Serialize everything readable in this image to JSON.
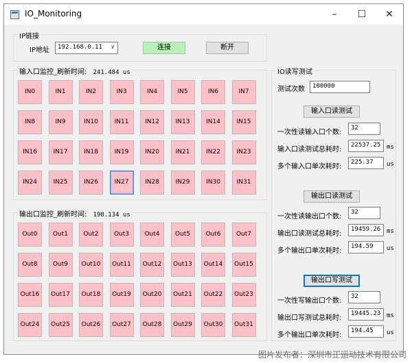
{
  "window": {
    "title": "IO_Monitoring",
    "minimize_label": "–",
    "maximize_label": "☐",
    "close_label": "✕"
  },
  "ip_group": {
    "title": "IP链接",
    "ip_label": "IP地址",
    "ip_value": "192.168.0.11",
    "connect_label": "连接",
    "disconnect_label": "断开"
  },
  "input_group": {
    "title": "输入口监控_刷新时间:",
    "refresh_time": "241.484 us",
    "cells": [
      "IN0",
      "IN1",
      "IN2",
      "IN3",
      "IN4",
      "IN5",
      "IN6",
      "IN7",
      "IN8",
      "IN9",
      "IN10",
      "IN11",
      "IN12",
      "IN13",
      "IN14",
      "IN15",
      "IN16",
      "IN17",
      "IN18",
      "IN19",
      "IN20",
      "IN21",
      "IN22",
      "IN23",
      "IN24",
      "IN25",
      "IN26",
      "IN27",
      "IN28",
      "IN29",
      "IN30",
      "IN31"
    ]
  },
  "output_group": {
    "title": "输出口监控_刷新时间:",
    "refresh_time": "198.134 us",
    "cells": [
      "Out0",
      "Out1",
      "Out2",
      "Out3",
      "Out4",
      "Out5",
      "Out6",
      "Out7",
      "Out8",
      "Out9",
      "Out10",
      "Out11",
      "Out12",
      "Out13",
      "Out14",
      "Out15",
      "Out16",
      "Out17",
      "Out18",
      "Out19",
      "Out20",
      "Out21",
      "Out22",
      "Out23",
      "Out24",
      "Out25",
      "Out26",
      "Out27",
      "Out28",
      "Out29",
      "Out30",
      "Out31"
    ]
  },
  "io_test": {
    "title": "IO读写测试",
    "count_label": "测试次数",
    "count_value": "100000",
    "input_read": {
      "button": "输入口读测试",
      "count_label": "一次性读输入口个数:",
      "count_value": "32",
      "total_label": "输入口读测试总耗时:",
      "total_value": "22537.25",
      "total_unit": "ms",
      "single_label": "多个输入口单次耗时:",
      "single_value": "225.37",
      "single_unit": "us"
    },
    "output_read": {
      "button": "输出口读测试",
      "count_label": "一次性读输出口个数:",
      "count_value": "32",
      "total_label": "输出口读测试总耗时:",
      "total_value": "19459.26",
      "total_unit": "ms",
      "single_label": "多个输出口单次耗时:",
      "single_value": "194.59",
      "single_unit": "us"
    },
    "output_write": {
      "button": "输出口写测试",
      "count_label": "一次性写输出口个数:",
      "count_value": "32",
      "total_label": "输出口写测试总耗时:",
      "total_value": "19445.23",
      "total_unit": "ms",
      "single_label": "多个输出口单次耗时:",
      "single_value": "194.45",
      "single_unit": "us"
    }
  },
  "watermark": "图片发布者：深圳市正运动技术有限公司"
}
